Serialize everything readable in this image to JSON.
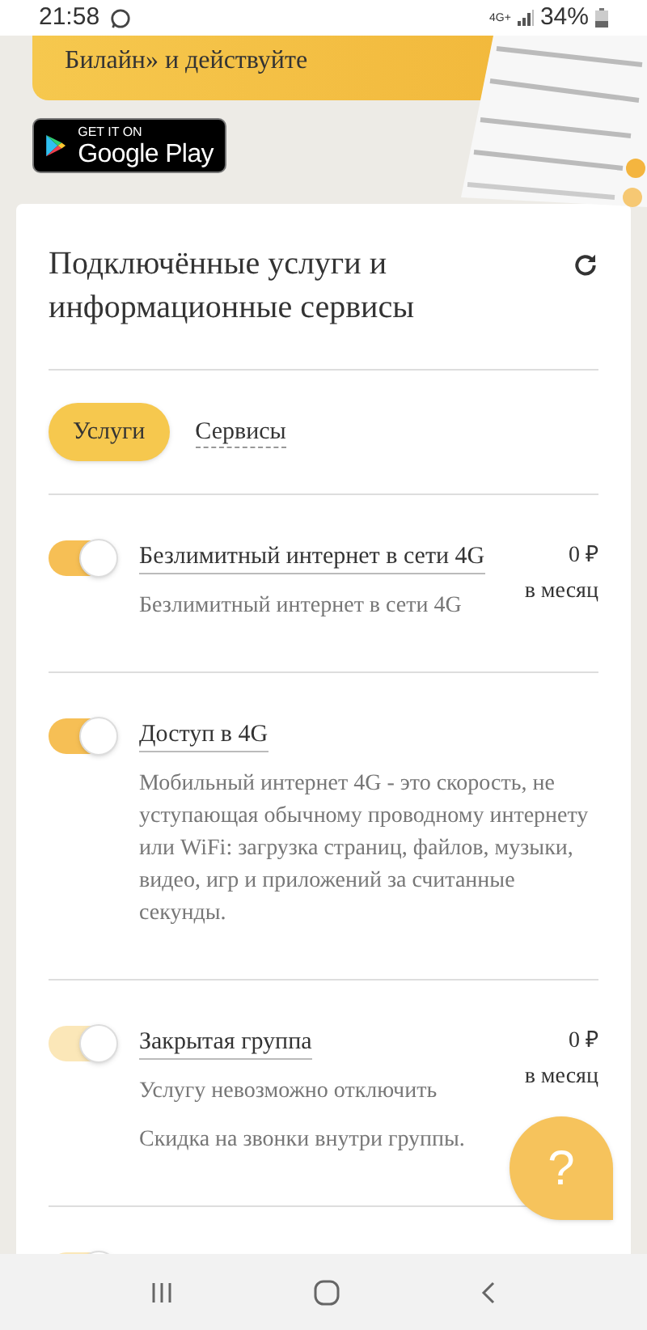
{
  "status_bar": {
    "time": "21:58",
    "network": "4G+",
    "battery": "34%"
  },
  "banner": {
    "text": "Билайн» и действуйте",
    "store_badge": {
      "small": "GET IT ON",
      "large": "Google Play"
    }
  },
  "card": {
    "title": "Подключённые услуги и информационные сервисы",
    "tabs": [
      {
        "label": "Услуги",
        "selected": true
      },
      {
        "label": "Сервисы",
        "selected": false
      }
    ],
    "services": [
      {
        "title": "Безлимитный интернет в сети 4G",
        "on": true,
        "disabled": false,
        "price": "0 ₽",
        "period": "в месяц",
        "descriptions": [
          "Безлимитный интернет в сети 4G"
        ]
      },
      {
        "title": "Доступ в 4G",
        "on": true,
        "disabled": false,
        "descriptions": [
          "Мобильный интернет 4G - это скорость, не уступающая обычному проводному интернету или WiFi: загрузка страниц, файлов, музыки, видео, игр и  приложений за считанные секунды."
        ]
      },
      {
        "title": "Закрытая группа",
        "on": true,
        "disabled": true,
        "price": "0 ₽",
        "period": "в месяц",
        "descriptions": [
          "Услугу невозможно отключить",
          "Скидка на звонки внутри группы."
        ]
      },
      {
        "on": true,
        "disabled": true
      }
    ]
  },
  "help_button": {
    "label": "?"
  }
}
